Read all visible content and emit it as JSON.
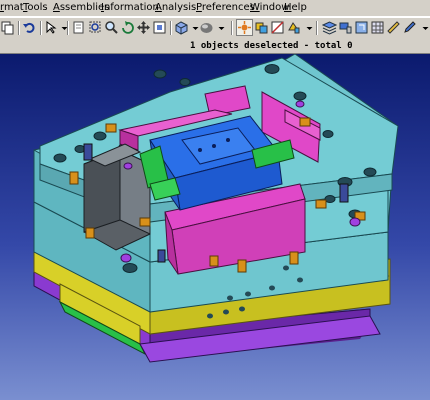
{
  "menu": {
    "items": [
      {
        "label": "rmat",
        "name": "menu-format"
      },
      {
        "label": "Tools",
        "name": "menu-tools"
      },
      {
        "label": "Assemblies",
        "name": "menu-assemblies"
      },
      {
        "label": "Information",
        "name": "menu-information"
      },
      {
        "label": "Analysis",
        "name": "menu-analysis"
      },
      {
        "label": "Preferences",
        "name": "menu-preferences"
      },
      {
        "label": "Window",
        "name": "menu-window"
      },
      {
        "label": "Help",
        "name": "menu-help"
      }
    ]
  },
  "toolbar": {
    "icons": [
      "copy-icon",
      "undo-icon",
      "select-filter-icon",
      "new-sheet-icon",
      "zoom-box-icon",
      "zoom-icon",
      "rotate-icon",
      "pan-icon",
      "fit-view-icon",
      "render-style-icon",
      "shading-icon",
      "snap-icon",
      "view-orient-icon",
      "section-icon",
      "clip-icon",
      "layers-icon",
      "paint-icon",
      "select-icon",
      "grid-icon",
      "measure-icon",
      "edit-icon",
      "more-icon"
    ]
  },
  "status": {
    "message": "1 objects deselected - total 0"
  },
  "colors": {
    "background_top": "#0b1a6e",
    "background_bottom": "#7a8fd0",
    "plate": "#6fc6cf",
    "plate_dark": "#3f8f9a",
    "magenta": "#e048c8",
    "blue": "#2a6fe8",
    "yellow": "#d8d028",
    "purple": "#8a3ad0",
    "gray_block": "#5a6066",
    "green": "#28c048",
    "orange": "#d8901a"
  }
}
